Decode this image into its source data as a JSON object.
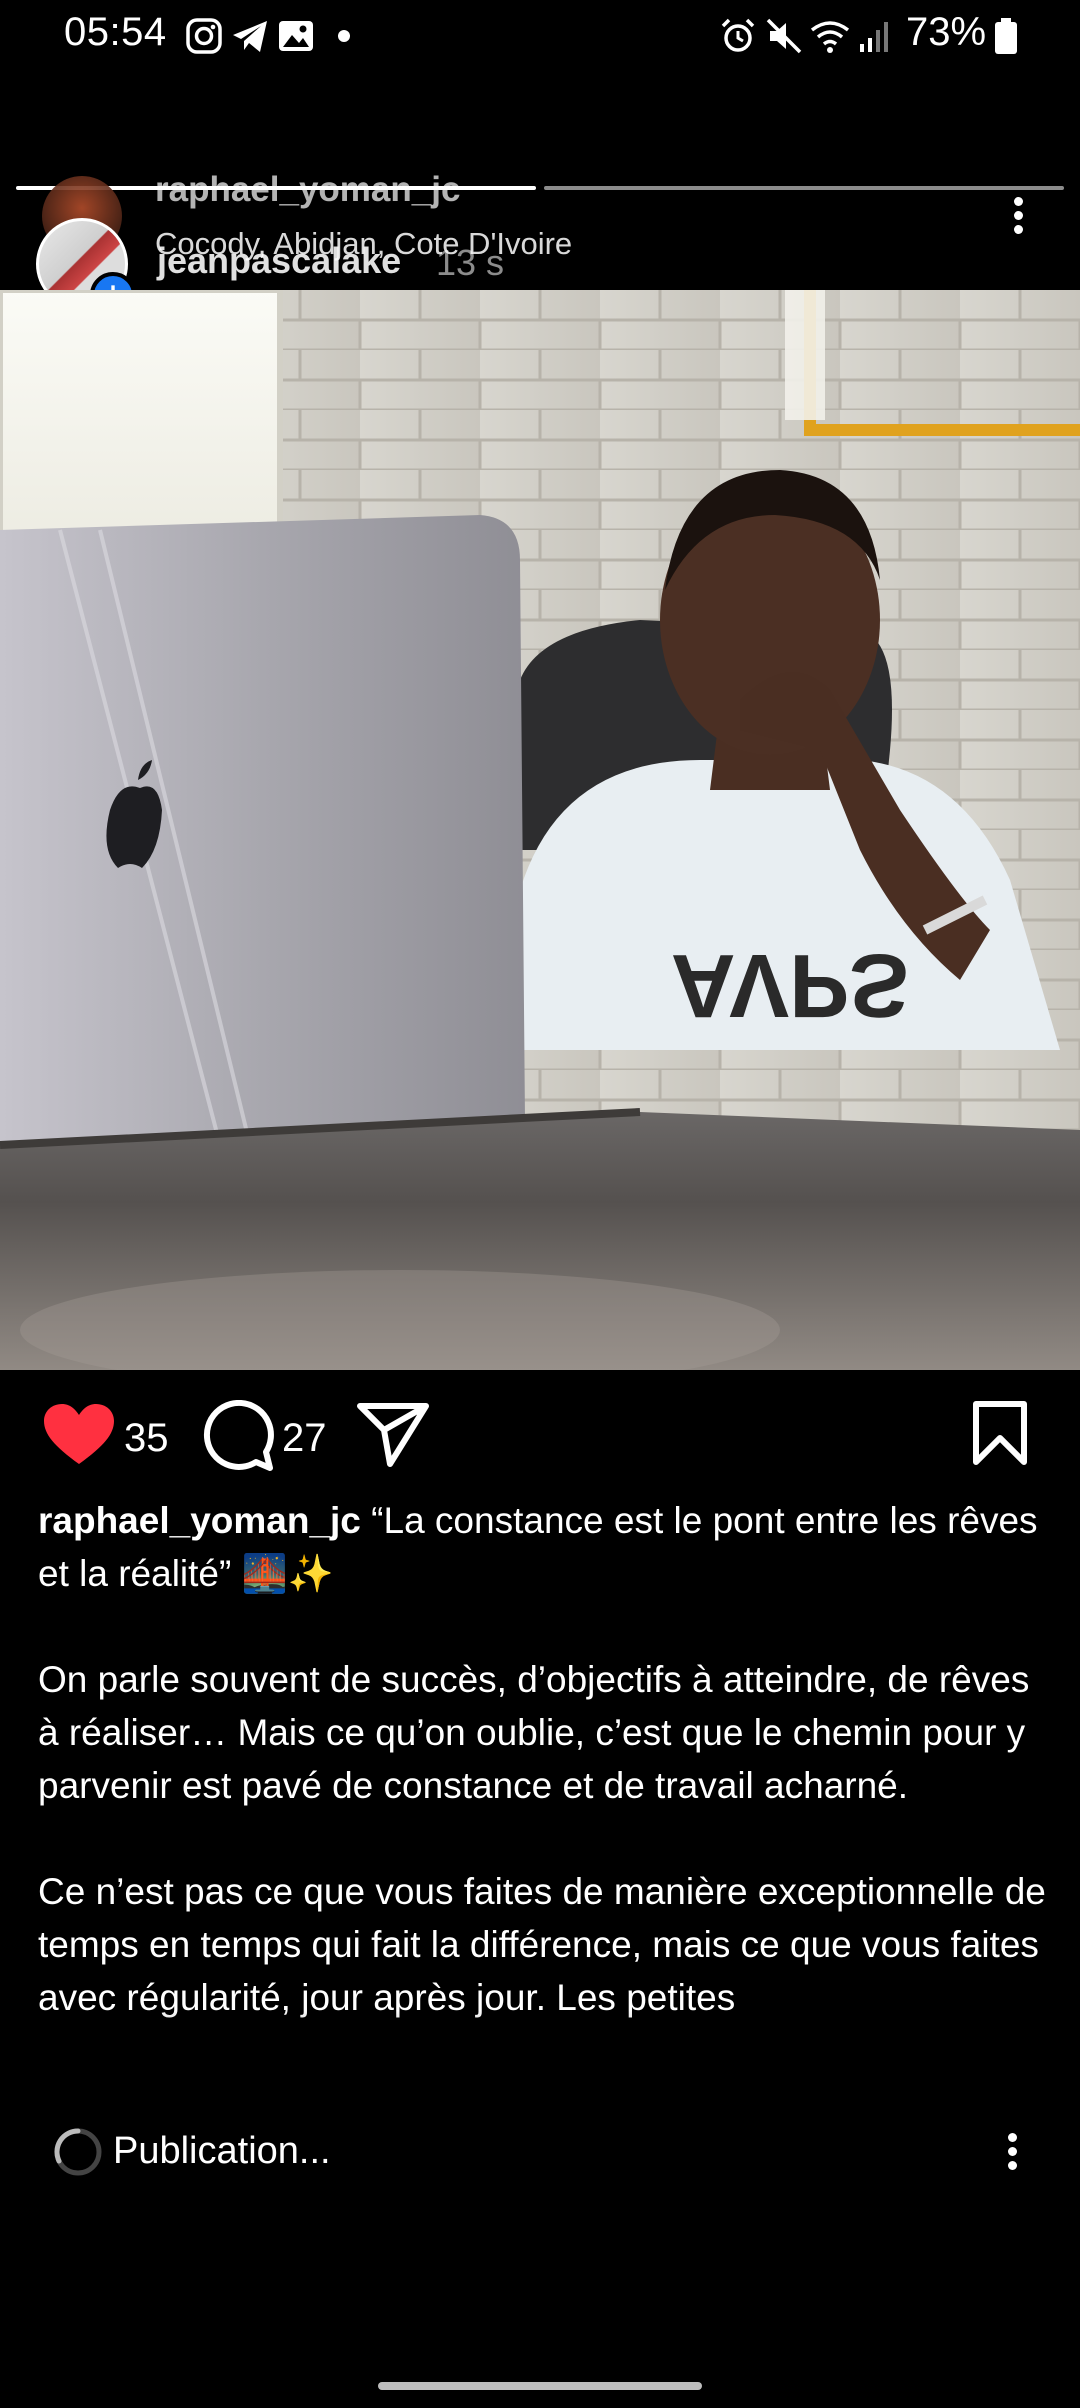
{
  "status_bar": {
    "time": "05:54",
    "battery": "73%",
    "left_icons": [
      "instagram-icon",
      "telegram-icon",
      "gallery-icon"
    ],
    "right_icons": [
      "alarm-icon",
      "mute-icon",
      "wifi-icon",
      "signal-icon",
      "battery-icon"
    ]
  },
  "story": {
    "username": "raphael_yoman_jc",
    "location": "Cocody, Abidjan, Cote D'Ivoire",
    "viewer_username": "jeanpascalake",
    "time_ago": "13 s",
    "progress": [
      1.0,
      0.0
    ]
  },
  "post": {
    "likes": "35",
    "comments": "27",
    "caption_user": "raphael_yoman_jc",
    "caption_first": " “La constance est le pont entre les rêves et la réalité” 🌉✨",
    "paragraph_1": "On parle souvent de succès, d’objectifs à atteindre, de rêves à réaliser… Mais ce qu’on oublie, c’est que le chemin pour y parvenir est pavé de constance et de travail acharné.",
    "paragraph_2": "Ce n’est pas ce que vous faites de manière exceptionnelle de temps en temps qui fait la différence, mais ce que vous faites avec régularité, jour après jour. Les petites",
    "photo_shirt_text": "AVPS"
  },
  "publishing": {
    "label": "Publication..."
  },
  "colors": {
    "background": "#000000",
    "like_red": "#ff3040",
    "badge_blue": "#1877f2"
  }
}
